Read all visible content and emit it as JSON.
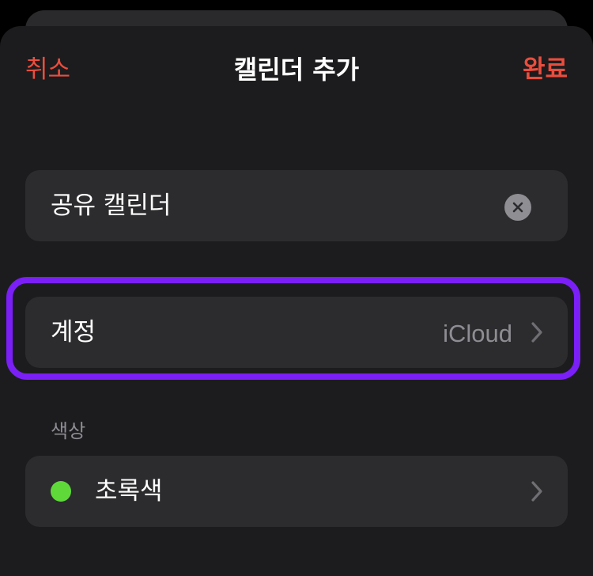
{
  "nav": {
    "cancel_label": "취소",
    "title": "캘린더 추가",
    "done_label": "완료"
  },
  "name_field": {
    "value": "공유 캘린더",
    "clear_icon": "clear-x-circle-icon"
  },
  "account_row": {
    "label": "계정",
    "value": "iCloud",
    "chevron_icon": "chevron-right-icon"
  },
  "color_section": {
    "header": "색상",
    "selected_label": "초록색",
    "selected_color": "#5fd93a",
    "chevron_icon": "chevron-right-icon"
  },
  "colors": {
    "accent": "#eb4d3d",
    "highlight": "#7b1ff7",
    "sheet_background": "#1c1c1e",
    "card_background": "#2c2c2e"
  }
}
